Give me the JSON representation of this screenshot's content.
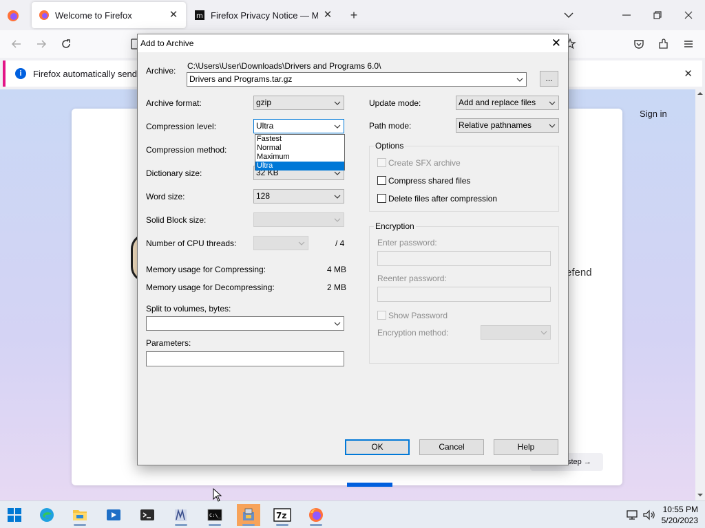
{
  "browser": {
    "tabs": [
      {
        "title": "Welcome to Firefox"
      },
      {
        "title": "Firefox Privacy Notice — Mozill"
      }
    ],
    "notification": {
      "text": "Firefox automatically sends so"
    },
    "page": {
      "sign_in": "Sign in",
      "partial_text": "efend",
      "next_step": "step →"
    }
  },
  "dialog": {
    "title": "Add to Archive",
    "archive": {
      "label": "Archive:",
      "path": "C:\\Users\\User\\Downloads\\Drivers and Programs 6.0\\",
      "filename": "Drivers and Programs.tar.gz",
      "browse_label": "..."
    },
    "left": {
      "archive_format": {
        "label": "Archive format:",
        "value": "gzip"
      },
      "compression_level": {
        "label": "Compression level:",
        "value": "Ultra",
        "options": [
          "Fastest",
          "Normal",
          "Maximum",
          "Ultra"
        ],
        "selected": "Ultra"
      },
      "compression_method": {
        "label": "Compression method:"
      },
      "dictionary_size": {
        "label": "Dictionary size:",
        "value": "32 KB"
      },
      "word_size": {
        "label": "Word size:",
        "value": "128"
      },
      "solid_block_size": {
        "label": "Solid Block size:",
        "value": ""
      },
      "cpu_threads": {
        "label": "Number of CPU threads:",
        "value": "",
        "total": "/ 4"
      },
      "mem_compress": {
        "label": "Memory usage for Compressing:",
        "value": "4 MB"
      },
      "mem_decompress": {
        "label": "Memory usage for Decompressing:",
        "value": "2 MB"
      },
      "split_volumes": {
        "label": "Split to volumes, bytes:",
        "value": ""
      },
      "parameters": {
        "label": "Parameters:",
        "value": ""
      }
    },
    "right": {
      "update_mode": {
        "label": "Update mode:",
        "value": "Add and replace files"
      },
      "path_mode": {
        "label": "Path mode:",
        "value": "Relative pathnames"
      },
      "options": {
        "title": "Options",
        "create_sfx": "Create SFX archive",
        "compress_shared": "Compress shared files",
        "delete_after": "Delete files after compression"
      },
      "encryption": {
        "title": "Encryption",
        "enter_password": "Enter password:",
        "reenter_password": "Reenter password:",
        "show_password": "Show Password",
        "method_label": "Encryption method:",
        "method_value": ""
      }
    },
    "buttons": {
      "ok": "OK",
      "cancel": "Cancel",
      "help": "Help"
    }
  },
  "taskbar": {
    "time": "10:55 PM",
    "date": "5/20/2023"
  },
  "colors": {
    "accent": "#0078d7",
    "firefox_blue": "#0060df"
  }
}
